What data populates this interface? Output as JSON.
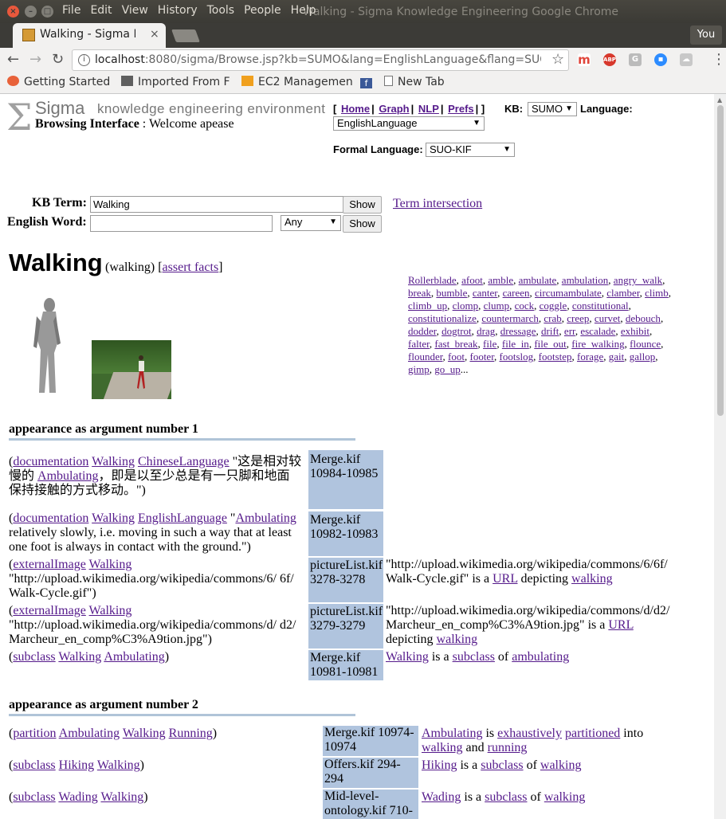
{
  "window": {
    "title": "Walking - Sigma Knowledge Engineering Google Chrome",
    "menu": [
      "File",
      "Edit",
      "View",
      "History",
      "Tools",
      "People",
      "Help"
    ],
    "profile": "You"
  },
  "tab": {
    "title": "Walking - Sigma Kn"
  },
  "address": {
    "host": "localhost",
    "rest": ":8080/sigma/Browse.jsp?kb=SUMO&lang=EnglishLanguage&flang=SUO-KIF&t..."
  },
  "bookmarks": [
    {
      "label": "Getting Started"
    },
    {
      "label": "Imported From F"
    },
    {
      "label": "EC2 Managemen"
    },
    {
      "label": ""
    },
    {
      "label": "New Tab"
    }
  ],
  "header": {
    "sigma": "Sigma",
    "sub": "knowledge engineering environment",
    "browsing": "Browsing Interface",
    "welcome": " : Welcome apease",
    "nav": [
      "Home",
      "Graph",
      "NLP",
      "Prefs"
    ],
    "kb_label": "KB:",
    "kb_value": "SUMO",
    "lang_label": "Language:",
    "lang_value": "EnglishLanguage",
    "flang_label": "Formal Language:",
    "flang_value": "SUO-KIF"
  },
  "search": {
    "kb_term_label": "KB Term:",
    "kb_term_value": "Walking",
    "english_label": "English Word:",
    "english_value": "",
    "any_value": "Any",
    "show_label": "Show",
    "term_intersection": "Term intersection"
  },
  "term": {
    "title": "Walking",
    "sub": "(walking)",
    "assert": "assert facts"
  },
  "synonyms": [
    "Rollerblade",
    "afoot",
    "amble",
    "ambulate",
    "ambulation",
    "angry_walk",
    "break",
    "bumble",
    "canter",
    "careen",
    "circumambulate",
    "clamber",
    "climb",
    "climb_up",
    "clomp",
    "clump",
    "cock",
    "coggle",
    "constitutional",
    "constitutionalize",
    "countermarch",
    "crab",
    "creep",
    "curvet",
    "debouch",
    "dodder",
    "dogtrot",
    "drag",
    "dressage",
    "drift",
    "err",
    "escalade",
    "exhibit",
    "falter",
    "fast_break",
    "file",
    "file_in",
    "file_out",
    "fire_walking",
    "flounce",
    "flounder",
    "foot",
    "footer",
    "footslog",
    "footstep",
    "forage",
    "gait",
    "gallop",
    "gimp",
    "go_up"
  ],
  "section1": {
    "title": "appearance as argument number 1",
    "rows": [
      {
        "a": "documentation",
        "b": "Walking",
        "c": "ChineseLanguage",
        "text1": " \"这是相对较慢的 ",
        "link": "Ambulating",
        "text2": "，即是以至少总是有一只脚和地面 保持接触的方式移动。\")",
        "src": "Merge.kif 10984-10985"
      },
      {
        "a": "documentation",
        "b": "Walking",
        "c": "EnglishLanguage",
        "text1": " \"",
        "link": "Ambulating",
        "text2": " relatively slowly, i.e. moving in such a way that at least one foot is always in contact with the ground.\")",
        "src": "Merge.kif 10982-10983"
      },
      {
        "a": "externalImage",
        "b": "Walking",
        "text": " \"http://upload.wikimedia.org/wikipedia/commons/6/ 6f/ Walk-Cycle.gif\")",
        "src": "pictureList.kif 3278-3278",
        "en1": "\"http://upload.wikimedia.org/wikipedia/commons/6/6f/ Walk-Cycle.gif\" is a ",
        "enlink1": "URL",
        "en2": " depicting ",
        "enlink2": "walking"
      },
      {
        "a": "externalImage",
        "b": "Walking",
        "text": " \"http://upload.wikimedia.org/wikipedia/commons/d/ d2/ Marcheur_en_comp%C3%A9tion.jpg\")",
        "src": "pictureList.kif 3279-3279",
        "en1": "\"http://upload.wikimedia.org/wikipedia/commons/d/d2/ Marcheur_en_comp%C3%A9tion.jpg\" is a ",
        "enlink1": "URL",
        "en2": " depicting ",
        "enlink2": "walking"
      },
      {
        "a": "subclass",
        "b": "Walking",
        "c": "Ambulating",
        "src": "Merge.kif 10981-10981",
        "enlink0": "Walking",
        "en1": " is a ",
        "enlink1": "subclass",
        "en2": " of ",
        "enlink2": "ambulating"
      }
    ]
  },
  "section2": {
    "title": "appearance as argument number 2",
    "rows": [
      {
        "a": "partition",
        "b": "Ambulating",
        "c": "Walking",
        "d": "Running",
        "src": "Merge.kif 10974-10974",
        "enlink0": "Ambulating",
        "en1": " is ",
        "enlink1": "exhaustively",
        "enlink2": "partitioned",
        "en2": " into ",
        "enlink3": "walking",
        "en3": " and ",
        "enlink4": "running"
      },
      {
        "a": "subclass",
        "b": "Hiking",
        "c": "Walking",
        "src": "Offers.kif 294-294",
        "enlink0": "Hiking",
        "en1": " is a ",
        "enlink1": "subclass",
        "en2": " of ",
        "enlink2": "walking"
      },
      {
        "a": "subclass",
        "b": "Wading",
        "c": "Walking",
        "src": "Mid-level-ontology.kif 710-",
        "enlink0": "Wading",
        "en1": " is a ",
        "enlink1": "subclass",
        "en2": " of ",
        "enlink2": "walking"
      }
    ]
  }
}
